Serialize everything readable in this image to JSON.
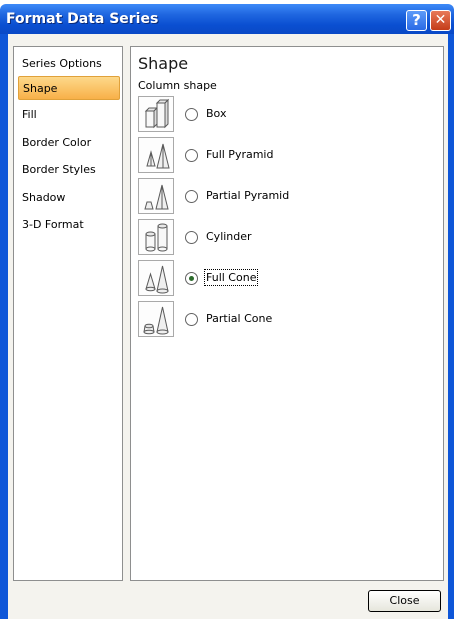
{
  "window": {
    "title": "Format Data Series",
    "help_glyph": "?",
    "close_glyph": "✕"
  },
  "nav": {
    "items": [
      {
        "label": "Series Options",
        "selected": false
      },
      {
        "label": "Shape",
        "selected": true
      },
      {
        "label": "Fill",
        "selected": false
      },
      {
        "label": "Border Color",
        "selected": false
      },
      {
        "label": "Border Styles",
        "selected": false
      },
      {
        "label": "Shadow",
        "selected": false
      },
      {
        "label": "3-D Format",
        "selected": false
      }
    ]
  },
  "content": {
    "title": "Shape",
    "subtitle": "Column shape",
    "options": [
      {
        "label": "Box",
        "icon": "box-icon",
        "checked": false
      },
      {
        "label": "Full Pyramid",
        "icon": "full-pyramid-icon",
        "checked": false
      },
      {
        "label": "Partial Pyramid",
        "icon": "partial-pyramid-icon",
        "checked": false
      },
      {
        "label": "Cylinder",
        "icon": "cylinder-icon",
        "checked": false
      },
      {
        "label": "Full Cone",
        "icon": "full-cone-icon",
        "checked": true
      },
      {
        "label": "Partial Cone",
        "icon": "partial-cone-icon",
        "checked": false
      }
    ]
  },
  "footer": {
    "close_label": "Close"
  },
  "colors": {
    "title_bar": "#0a4fd1",
    "selected_nav": "#f8b048",
    "radio_dot": "#2c6b2c"
  }
}
